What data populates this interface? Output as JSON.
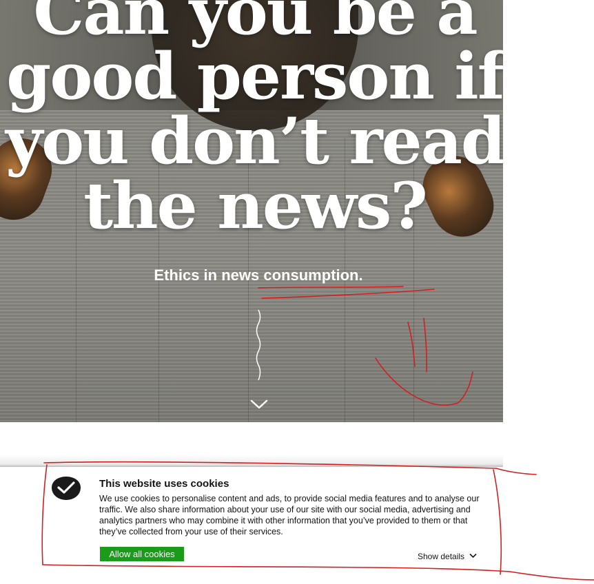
{
  "hero": {
    "headline": "Can you be a good person if you don’t read the news?",
    "subtitle": "Ethics in news consumption.",
    "scroll_icon": "chevron-down-icon"
  },
  "cookie_banner": {
    "title": "This website uses cookies",
    "description": "We use cookies to personalise content and ads, to provide social media features and to analyse our traffic. We also share information about your use of our site with our social media, advertising and analytics partners who may combine it with other information that you’ve provided to them or that they’ve collected from your use of their services.",
    "allow_button": "Allow all cookies",
    "show_details": "Show details",
    "logo_icon": "checkmark-badge-icon",
    "colors": {
      "allow_button_bg": "#1a9b1a",
      "annotation_red": "#d21f1f"
    }
  }
}
